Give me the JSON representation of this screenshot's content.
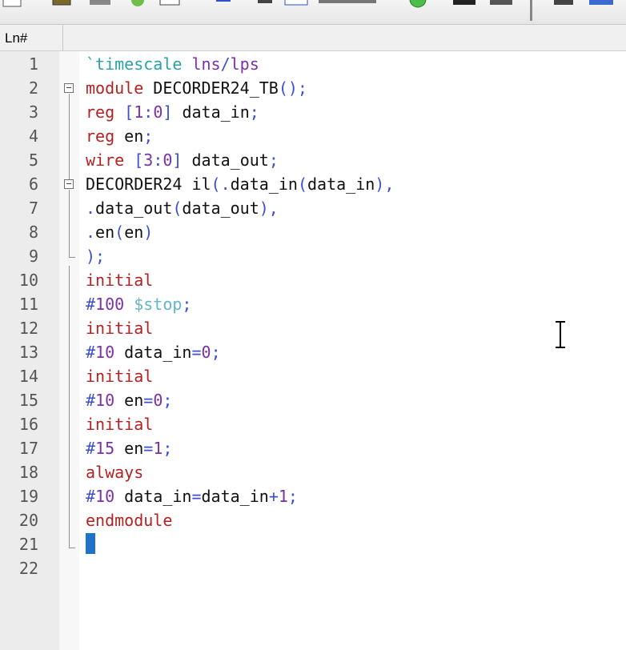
{
  "header": {
    "ln_label": "Ln#"
  },
  "toolbar": {
    "icons": [
      "doc-icon",
      "open-folder-icon",
      "tools-icon",
      "run-icon",
      "dialog-icon",
      "arrow-icon",
      "dots-icon",
      "window-icon",
      "ruler-icon",
      "green-circle-icon",
      "blocks-icon",
      "grid-icon",
      "divider-icon",
      "settings-icon",
      "window2-icon"
    ]
  },
  "editor": {
    "line_numbers": [
      "1",
      "2",
      "3",
      "4",
      "5",
      "6",
      "7",
      "8",
      "9",
      "10",
      "11",
      "12",
      "13",
      "14",
      "15",
      "16",
      "17",
      "18",
      "19",
      "20",
      "21",
      "22"
    ],
    "lines": [
      [
        [
          "`timescale ",
          "ph"
        ],
        [
          "lns",
          "num"
        ],
        [
          "/",
          "op"
        ],
        [
          "lps",
          "num"
        ]
      ],
      [
        [
          "module",
          "kw"
        ],
        [
          " DECORDER24_TB",
          "txt"
        ],
        [
          "();",
          "op"
        ]
      ],
      [
        [
          "reg",
          "kw"
        ],
        [
          " [",
          "op"
        ],
        [
          "1",
          "num"
        ],
        [
          ":",
          "op"
        ],
        [
          "0",
          "num"
        ],
        [
          "]",
          "op"
        ],
        [
          " data_in",
          "txt"
        ],
        [
          ";",
          "op"
        ]
      ],
      [
        [
          "reg",
          "kw"
        ],
        [
          " en",
          "txt"
        ],
        [
          ";",
          "op"
        ]
      ],
      [
        [
          "wire",
          "kw"
        ],
        [
          " [",
          "op"
        ],
        [
          "3",
          "num"
        ],
        [
          ":",
          "op"
        ],
        [
          "0",
          "num"
        ],
        [
          "]",
          "op"
        ],
        [
          " data_out",
          "txt"
        ],
        [
          ";",
          "op"
        ]
      ],
      [
        [
          "DECORDER24 il",
          "txt"
        ],
        [
          "(.",
          "op"
        ],
        [
          "data_in",
          "txt"
        ],
        [
          "(",
          "op"
        ],
        [
          "data_in",
          "txt"
        ],
        [
          "),",
          "op"
        ]
      ],
      [
        [
          ".",
          "op"
        ],
        [
          "data_out",
          "txt"
        ],
        [
          "(",
          "op"
        ],
        [
          "data_out",
          "txt"
        ],
        [
          "),",
          "op"
        ]
      ],
      [
        [
          ".",
          "op"
        ],
        [
          "en",
          "txt"
        ],
        [
          "(",
          "op"
        ],
        [
          "en",
          "txt"
        ],
        [
          ")",
          "op"
        ]
      ],
      [
        [
          ");",
          "op"
        ]
      ],
      [
        [
          "initial",
          "kw"
        ]
      ],
      [
        [
          "#",
          "op"
        ],
        [
          "100",
          "num"
        ],
        [
          " $stop",
          "sys"
        ],
        [
          ";",
          "op"
        ]
      ],
      [
        [
          "initial",
          "kw"
        ]
      ],
      [
        [
          "#",
          "op"
        ],
        [
          "10",
          "num"
        ],
        [
          " data_in",
          "txt"
        ],
        [
          "=",
          "op"
        ],
        [
          "0",
          "num"
        ],
        [
          ";",
          "op"
        ]
      ],
      [
        [
          "initial",
          "kw"
        ]
      ],
      [
        [
          "#",
          "op"
        ],
        [
          "10",
          "num"
        ],
        [
          " en",
          "txt"
        ],
        [
          "=",
          "op"
        ],
        [
          "0",
          "num"
        ],
        [
          ";",
          "op"
        ]
      ],
      [
        [
          "initial",
          "kw"
        ]
      ],
      [
        [
          "#",
          "op"
        ],
        [
          "15",
          "num"
        ],
        [
          " en",
          "txt"
        ],
        [
          "=",
          "op"
        ],
        [
          "1",
          "num"
        ],
        [
          ";",
          "op"
        ]
      ],
      [
        [
          "always",
          "kw"
        ]
      ],
      [
        [
          "#",
          "op"
        ],
        [
          "10",
          "num"
        ],
        [
          " data_in",
          "txt"
        ],
        [
          "=",
          "op"
        ],
        [
          "data_in",
          "txt"
        ],
        [
          "+",
          "op"
        ],
        [
          "1",
          "num"
        ],
        [
          ";",
          "op"
        ]
      ],
      [
        [
          "endmodule",
          "kw"
        ]
      ],
      [],
      []
    ]
  }
}
